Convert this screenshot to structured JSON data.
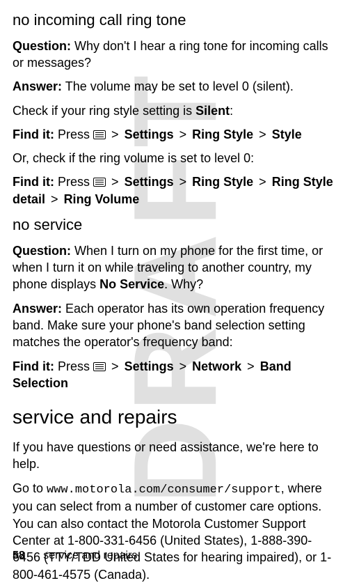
{
  "watermark": "DRAFT",
  "sec1": {
    "heading": "no incoming call ring tone",
    "q_label": "Question:",
    "q_text": "Why don't I hear a ring tone for incoming calls or messages?",
    "a_label": "Answer:",
    "a_text": "The volume may be set to level 0 (silent).",
    "check_pre": "Check if your ring style setting is ",
    "check_val": "Silent",
    "check_post": ":",
    "find1_label": "Find it:",
    "find1_press": "Press",
    "path1": {
      "a": "Settings",
      "b": "Ring Style",
      "c": "Style"
    },
    "or_line": "Or, check if the ring volume is set to level 0:",
    "find2_label": "Find it:",
    "find2_press": "Press",
    "path2": {
      "a": "Settings",
      "b": "Ring Style",
      "c": "Ring Style detail",
      "d": "Ring Volume"
    }
  },
  "sec2": {
    "heading": "no service",
    "q_label": "Question:",
    "q_text_pre": "When I turn on my phone for the first time, or when I turn it on while traveling to another country, my phone displays ",
    "q_val": "No Service",
    "q_text_post": ". Why?",
    "a_label": "Answer:",
    "a_text": "Each operator has its own operation frequency band. Make sure your phone's band selection setting matches the operator's frequency band:",
    "find_label": "Find it:",
    "find_press": "Press",
    "path": {
      "a": "Settings",
      "b": "Network",
      "c": "Band Selection"
    }
  },
  "sec3": {
    "heading": "service and repairs",
    "p1": "If you have questions or need assistance, we're here to help.",
    "p2_pre": "Go to ",
    "p2_url": "www.motorola.com/consumer/support",
    "p2_post": ", where you can select from a number of customer care options. You can also contact the Motorola Customer Support Center at 1-800-331-6456 (United States), 1-888-390-6456 (TTY/TDD United States for hearing impaired), or 1-800-461-4575 (Canada)."
  },
  "footer": {
    "page": "58",
    "section": "service and repairs"
  },
  "gt": ">"
}
